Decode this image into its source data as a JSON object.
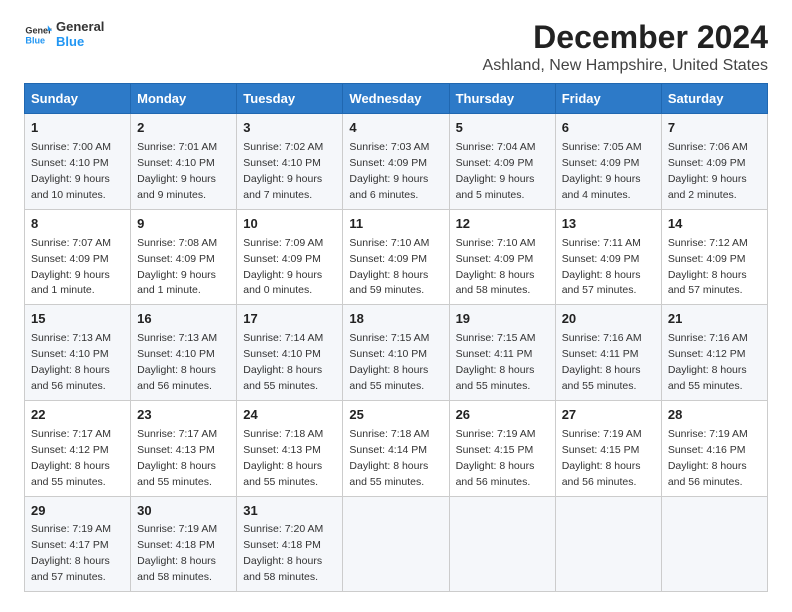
{
  "header": {
    "logo_line1": "General",
    "logo_line2": "Blue",
    "title": "December 2024",
    "subtitle": "Ashland, New Hampshire, United States"
  },
  "weekdays": [
    "Sunday",
    "Monday",
    "Tuesday",
    "Wednesday",
    "Thursday",
    "Friday",
    "Saturday"
  ],
  "weeks": [
    [
      {
        "day": "1",
        "sunrise": "7:00 AM",
        "sunset": "4:10 PM",
        "daylight": "9 hours and 10 minutes."
      },
      {
        "day": "2",
        "sunrise": "7:01 AM",
        "sunset": "4:10 PM",
        "daylight": "9 hours and 9 minutes."
      },
      {
        "day": "3",
        "sunrise": "7:02 AM",
        "sunset": "4:10 PM",
        "daylight": "9 hours and 7 minutes."
      },
      {
        "day": "4",
        "sunrise": "7:03 AM",
        "sunset": "4:09 PM",
        "daylight": "9 hours and 6 minutes."
      },
      {
        "day": "5",
        "sunrise": "7:04 AM",
        "sunset": "4:09 PM",
        "daylight": "9 hours and 5 minutes."
      },
      {
        "day": "6",
        "sunrise": "7:05 AM",
        "sunset": "4:09 PM",
        "daylight": "9 hours and 4 minutes."
      },
      {
        "day": "7",
        "sunrise": "7:06 AM",
        "sunset": "4:09 PM",
        "daylight": "9 hours and 2 minutes."
      }
    ],
    [
      {
        "day": "8",
        "sunrise": "7:07 AM",
        "sunset": "4:09 PM",
        "daylight": "9 hours and 1 minute."
      },
      {
        "day": "9",
        "sunrise": "7:08 AM",
        "sunset": "4:09 PM",
        "daylight": "9 hours and 1 minute."
      },
      {
        "day": "10",
        "sunrise": "7:09 AM",
        "sunset": "4:09 PM",
        "daylight": "9 hours and 0 minutes."
      },
      {
        "day": "11",
        "sunrise": "7:10 AM",
        "sunset": "4:09 PM",
        "daylight": "8 hours and 59 minutes."
      },
      {
        "day": "12",
        "sunrise": "7:10 AM",
        "sunset": "4:09 PM",
        "daylight": "8 hours and 58 minutes."
      },
      {
        "day": "13",
        "sunrise": "7:11 AM",
        "sunset": "4:09 PM",
        "daylight": "8 hours and 57 minutes."
      },
      {
        "day": "14",
        "sunrise": "7:12 AM",
        "sunset": "4:09 PM",
        "daylight": "8 hours and 57 minutes."
      }
    ],
    [
      {
        "day": "15",
        "sunrise": "7:13 AM",
        "sunset": "4:10 PM",
        "daylight": "8 hours and 56 minutes."
      },
      {
        "day": "16",
        "sunrise": "7:13 AM",
        "sunset": "4:10 PM",
        "daylight": "8 hours and 56 minutes."
      },
      {
        "day": "17",
        "sunrise": "7:14 AM",
        "sunset": "4:10 PM",
        "daylight": "8 hours and 55 minutes."
      },
      {
        "day": "18",
        "sunrise": "7:15 AM",
        "sunset": "4:10 PM",
        "daylight": "8 hours and 55 minutes."
      },
      {
        "day": "19",
        "sunrise": "7:15 AM",
        "sunset": "4:11 PM",
        "daylight": "8 hours and 55 minutes."
      },
      {
        "day": "20",
        "sunrise": "7:16 AM",
        "sunset": "4:11 PM",
        "daylight": "8 hours and 55 minutes."
      },
      {
        "day": "21",
        "sunrise": "7:16 AM",
        "sunset": "4:12 PM",
        "daylight": "8 hours and 55 minutes."
      }
    ],
    [
      {
        "day": "22",
        "sunrise": "7:17 AM",
        "sunset": "4:12 PM",
        "daylight": "8 hours and 55 minutes."
      },
      {
        "day": "23",
        "sunrise": "7:17 AM",
        "sunset": "4:13 PM",
        "daylight": "8 hours and 55 minutes."
      },
      {
        "day": "24",
        "sunrise": "7:18 AM",
        "sunset": "4:13 PM",
        "daylight": "8 hours and 55 minutes."
      },
      {
        "day": "25",
        "sunrise": "7:18 AM",
        "sunset": "4:14 PM",
        "daylight": "8 hours and 55 minutes."
      },
      {
        "day": "26",
        "sunrise": "7:19 AM",
        "sunset": "4:15 PM",
        "daylight": "8 hours and 56 minutes."
      },
      {
        "day": "27",
        "sunrise": "7:19 AM",
        "sunset": "4:15 PM",
        "daylight": "8 hours and 56 minutes."
      },
      {
        "day": "28",
        "sunrise": "7:19 AM",
        "sunset": "4:16 PM",
        "daylight": "8 hours and 56 minutes."
      }
    ],
    [
      {
        "day": "29",
        "sunrise": "7:19 AM",
        "sunset": "4:17 PM",
        "daylight": "8 hours and 57 minutes."
      },
      {
        "day": "30",
        "sunrise": "7:19 AM",
        "sunset": "4:18 PM",
        "daylight": "8 hours and 58 minutes."
      },
      {
        "day": "31",
        "sunrise": "7:20 AM",
        "sunset": "4:18 PM",
        "daylight": "8 hours and 58 minutes."
      },
      null,
      null,
      null,
      null
    ]
  ]
}
